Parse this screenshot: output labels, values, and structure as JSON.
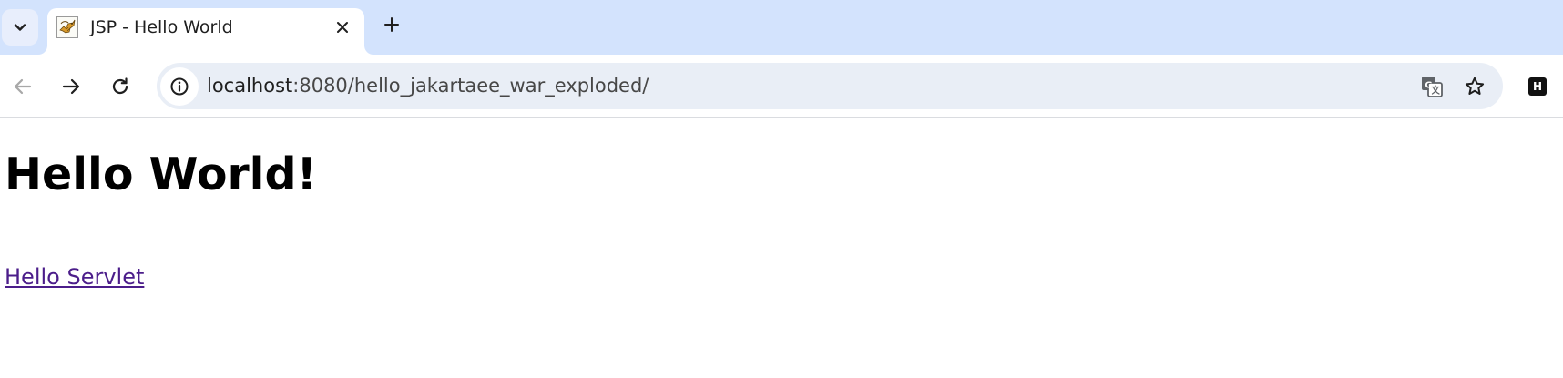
{
  "browser": {
    "tab": {
      "title": "JSP - Hello World",
      "favicon": "tomcat-icon"
    },
    "omnibox": {
      "url_host": "localhost",
      "url_rest": ":8080/hello_jakartaee_war_exploded/"
    },
    "extension_badge": "H",
    "icons": {
      "tab_search": "chevron-down-icon",
      "close": "close-icon",
      "new_tab": "plus-icon",
      "back": "back-arrow-icon",
      "forward": "forward-arrow-icon",
      "reload": "reload-icon",
      "site_info": "info-icon",
      "translate": "translate-icon",
      "bookmark": "star-icon"
    },
    "colors": {
      "tabstrip": "#d3e3fd",
      "omnibox": "#e9eef6",
      "link_visited": "#4b1d8a"
    }
  },
  "page": {
    "heading": "Hello World!",
    "link_text": "Hello Servlet"
  }
}
